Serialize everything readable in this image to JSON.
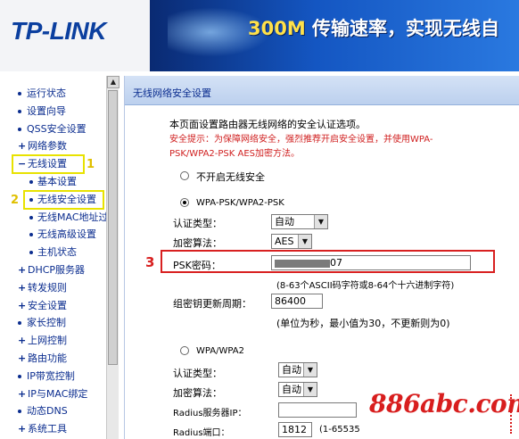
{
  "header": {
    "logo": "TP-LINK",
    "slogan_num": "300M",
    "slogan_text": "传输速率，实现无线自"
  },
  "sidebar": {
    "items": [
      {
        "label": "运行状态",
        "type": "top",
        "sym": "dot"
      },
      {
        "label": "设置向导",
        "type": "top",
        "sym": "dot"
      },
      {
        "label": "QSS安全设置",
        "type": "top",
        "sym": "dot"
      },
      {
        "label": "网络参数",
        "type": "top",
        "sym": "+"
      },
      {
        "label": "无线设置",
        "type": "top",
        "sym": "-"
      },
      {
        "label": "基本设置",
        "type": "sub"
      },
      {
        "label": "无线安全设置",
        "type": "sub"
      },
      {
        "label": "无线MAC地址过滤",
        "type": "sub"
      },
      {
        "label": "无线高级设置",
        "type": "sub"
      },
      {
        "label": "主机状态",
        "type": "sub"
      },
      {
        "label": "DHCP服务器",
        "type": "top",
        "sym": "+"
      },
      {
        "label": "转发规则",
        "type": "top",
        "sym": "+"
      },
      {
        "label": "安全设置",
        "type": "top",
        "sym": "+"
      },
      {
        "label": "家长控制",
        "type": "top",
        "sym": "dot"
      },
      {
        "label": "上网控制",
        "type": "top",
        "sym": "+"
      },
      {
        "label": "路由功能",
        "type": "top",
        "sym": "+"
      },
      {
        "label": "IP带宽控制",
        "type": "top",
        "sym": "dot"
      },
      {
        "label": "IP与MAC绑定",
        "type": "top",
        "sym": "+"
      },
      {
        "label": "动态DNS",
        "type": "top",
        "sym": "dot"
      },
      {
        "label": "系统工具",
        "type": "top",
        "sym": "+"
      }
    ]
  },
  "annotations": {
    "n1": "1",
    "n2": "2",
    "n3": "3"
  },
  "panel": {
    "title": "无线网络安全设置",
    "intro": "本页面设置路由器无线网络的安全认证选项。",
    "warning_line1": "安全提示：为保障网络安全，强烈推荐开启安全设置，并使用WPA-",
    "warning_line2": "PSK/WPA2-PSK AES加密方法。",
    "opt_none": "不开启无线安全",
    "opt_psk": "WPA-PSK/WPA2-PSK",
    "auth_label": "认证类型：",
    "auth_value": "自动",
    "enc_label": "加密算法：",
    "enc_value": "AES",
    "psk_label": "PSK密码：",
    "psk_value_suffix": "07",
    "psk_hint": "(8-63个ASCII码字符或8-64个十六进制字符)",
    "renew_label": "组密钥更新周期：",
    "renew_value": "86400",
    "renew_hint": "(单位为秒，最小值为30，不更新则为0)",
    "opt_wpa": "WPA/WPA2",
    "auth2_label": "认证类型：",
    "auth2_value": "自动",
    "enc2_label": "加密算法：",
    "enc2_value": "自动",
    "radius_ip_label": "Radius服务器IP：",
    "radius_port_label": "Radius端口：",
    "radius_port_value": "1812",
    "radius_port_hint": "(1-65535"
  },
  "watermark": "886abc.com"
}
